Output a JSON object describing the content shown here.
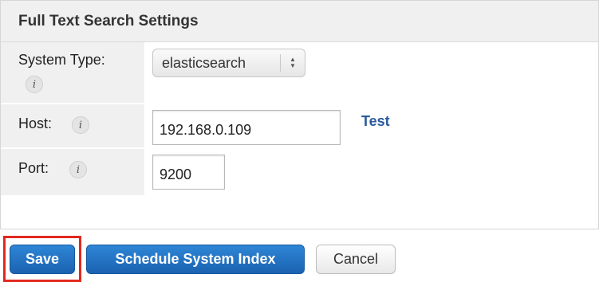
{
  "panel": {
    "title": "Full Text Search Settings",
    "system_type": {
      "label": "System Type:",
      "value": "elasticsearch",
      "info_icon": "info-icon"
    },
    "host": {
      "label": "Host:",
      "value": "192.168.0.109",
      "info_icon": "info-icon",
      "test_link": "Test"
    },
    "port": {
      "label": "Port:",
      "value": "9200",
      "info_icon": "info-icon"
    }
  },
  "actions": {
    "save": "Save",
    "schedule": "Schedule System Index",
    "cancel": "Cancel"
  },
  "colors": {
    "primary_button": "#1a63b0",
    "link": "#2a5a9b",
    "highlight": "#e2281e",
    "label_background": "#f0f0f0"
  }
}
